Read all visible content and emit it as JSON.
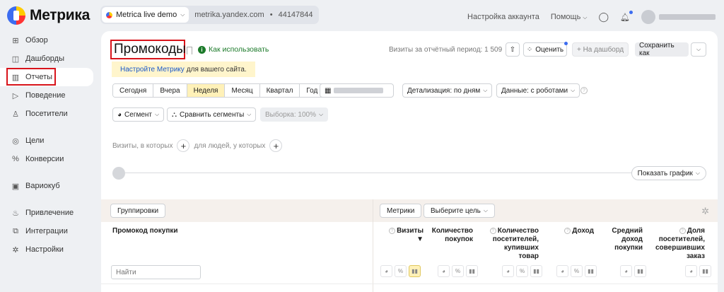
{
  "app": {
    "logo": "Метрика"
  },
  "counter": {
    "name": "Metrica live demo",
    "site": "metrika.yandex.com",
    "id": "44147844"
  },
  "top": {
    "account": "Настройка аккаунта",
    "help": "Помощь"
  },
  "sidebar": {
    "items": [
      {
        "label": "Обзор",
        "icon": "grid-icon"
      },
      {
        "label": "Дашборды",
        "icon": "dashboard-icon"
      },
      {
        "label": "Отчеты",
        "icon": "reports-icon"
      },
      {
        "label": "Поведение",
        "icon": "play-icon"
      },
      {
        "label": "Посетители",
        "icon": "person-icon"
      },
      {
        "label": "Цели",
        "icon": "target-icon"
      },
      {
        "label": "Конверсии",
        "icon": "percent-icon"
      },
      {
        "label": "Вариокуб",
        "icon": "cube-icon"
      },
      {
        "label": "Привлечение",
        "icon": "flame-icon"
      },
      {
        "label": "Интеграции",
        "icon": "puzzle-icon"
      },
      {
        "label": "Настройки",
        "icon": "gear-icon"
      }
    ]
  },
  "report": {
    "title": "Промокоды",
    "howto": "Как использовать",
    "visits_period": "Визиты за отчётный период: 1 509",
    "rate": "Оценить",
    "to_dashboard": "+ На дашборд",
    "save_as": "Сохранить как"
  },
  "banner": {
    "link": "Настройте Метрику",
    "text": "для вашего сайта."
  },
  "periods": [
    "Сегодня",
    "Вчера",
    "Неделя",
    "Месяц",
    "Квартал",
    "Год"
  ],
  "controls": {
    "detail": "Детализация: по дням",
    "data": "Данные: с роботами",
    "segment": "Сегмент",
    "compare": "Сравнить сегменты",
    "sample": "Выборка: 100%"
  },
  "filters": {
    "visits_where": "Визиты, в которых",
    "people_where": "для людей, у которых"
  },
  "graph": {
    "show": "Показать график"
  },
  "table": {
    "groupings": "Группировки",
    "metrics": "Метрики",
    "goal": "Выберите цель",
    "dimension": "Промокод покупки",
    "search_placeholder": "Найти",
    "columns": [
      {
        "label": "Визиты ▼"
      },
      {
        "label": "Количество покупок"
      },
      {
        "label": "Количество посетителей, купивших товар"
      },
      {
        "label": "Доход"
      },
      {
        "label": "Средний доход покупки"
      },
      {
        "label": "Доля посетителей, совершивших заказ"
      }
    ]
  }
}
